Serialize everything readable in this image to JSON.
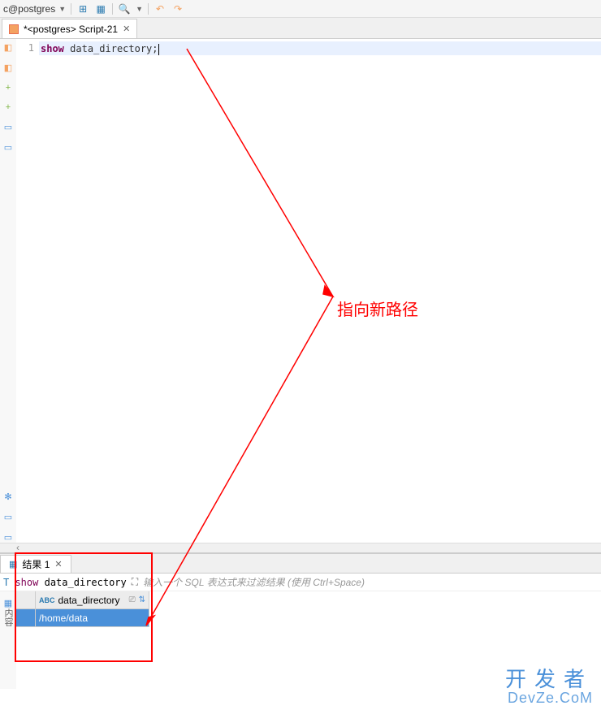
{
  "toolbar": {
    "db_label": "c@postgres"
  },
  "editor_tab": {
    "label": "*<postgres> Script-21"
  },
  "editor": {
    "line_number": "1",
    "keyword": "show",
    "identifier": "data_directory",
    "terminator": ";"
  },
  "results_tab": {
    "label": "结果 1"
  },
  "filter_bar": {
    "prefix": "T ",
    "sql_keyword": "show",
    "sql_ident": "data_directory",
    "placeholder": "输入一个 SQL 表达式来过滤结果 (使用 Ctrl+Space)"
  },
  "grid": {
    "type_badge": "ABC",
    "column_header": "data_directory",
    "row_value": "/home/data"
  },
  "annotation": {
    "label": "指向新路径"
  },
  "watermark": {
    "line1": "开发者",
    "line2": "DevZe.CoM"
  },
  "sidebar_vertical": "内容"
}
